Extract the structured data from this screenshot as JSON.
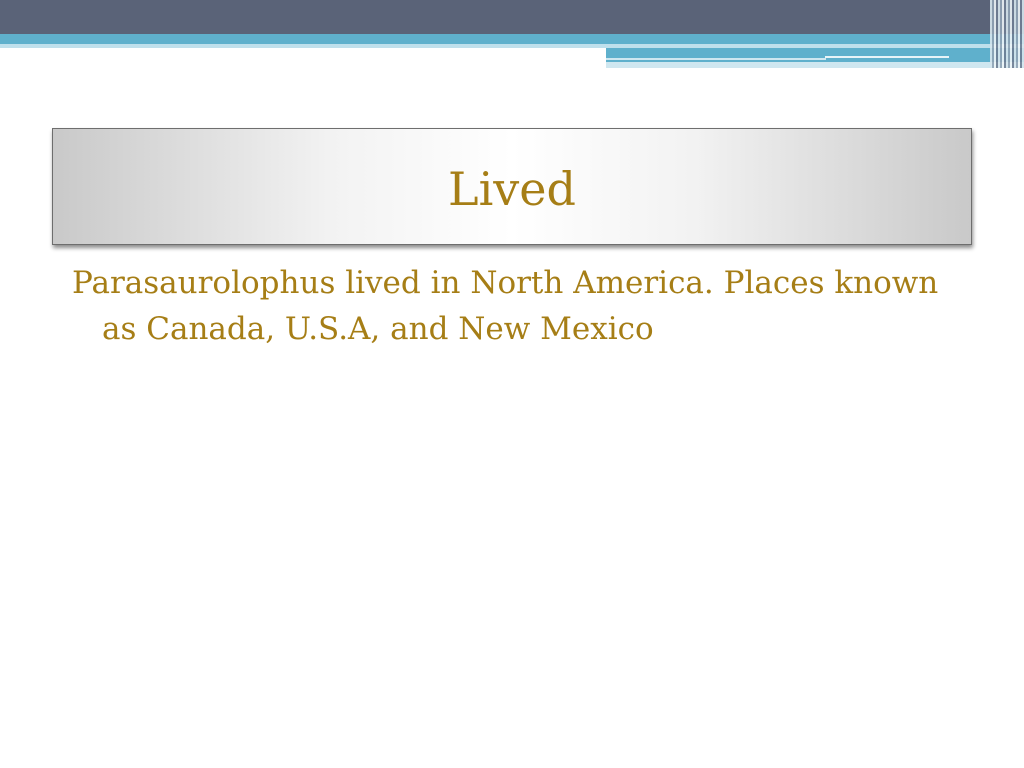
{
  "slide": {
    "title": "Lived",
    "body": "Parasaurolophus lived in North America. Places known as Canada, U.S.A, and New Mexico"
  },
  "colors": {
    "text_gold": "#a67e16",
    "band_dark": "#5a6378",
    "band_blue": "#5fb0cc",
    "background": "#ffffff"
  }
}
